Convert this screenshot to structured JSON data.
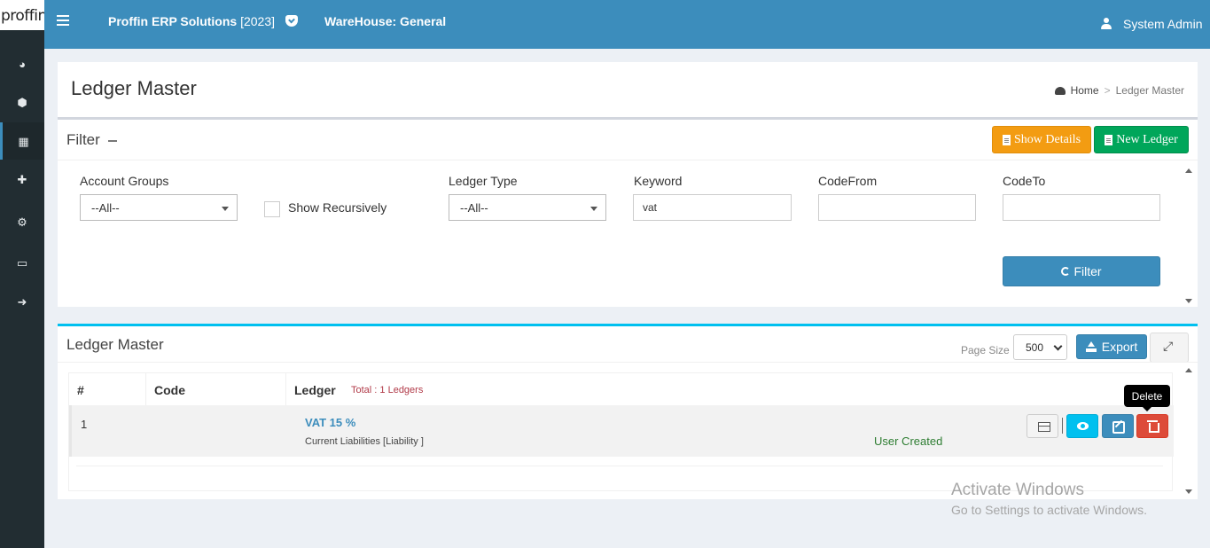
{
  "logo": {
    "text": "proffin"
  },
  "header": {
    "app_title": "Proffin ERP Solutions",
    "app_year": "[2023]",
    "warehouse": "WareHouse: General",
    "user_name": "System Admin"
  },
  "sidebar": {
    "items": [
      {
        "icon": "dashboard-icon"
      },
      {
        "icon": "cubes-icon"
      },
      {
        "icon": "calculator-icon",
        "active": true
      },
      {
        "icon": "puzzle-icon"
      },
      {
        "icon": "cogs-icon"
      },
      {
        "icon": "laptop-icon"
      },
      {
        "icon": "sign-out-icon"
      }
    ]
  },
  "page": {
    "title": "Ledger Master",
    "breadcrumb": {
      "home": "Home",
      "sep": ">",
      "current": "Ledger Master"
    }
  },
  "filter": {
    "title": "Filter",
    "show_details": "Show Details",
    "new_ledger": "New Ledger",
    "account_groups_label": "Account Groups",
    "account_groups_value": "--All--",
    "show_recursively": "Show Recursively",
    "ledger_type_label": "Ledger Type",
    "ledger_type_value": "--All--",
    "keyword_label": "Keyword",
    "keyword_value": "vat",
    "code_from_label": "CodeFrom",
    "code_from_value": "",
    "code_to_label": "CodeTo",
    "code_to_value": "",
    "filter_button": "Filter"
  },
  "ledger": {
    "title": "Ledger Master",
    "page_size_label": "Page Size",
    "page_size_value": "500",
    "export_button": "Export",
    "columns": {
      "num": "#",
      "code": "Code",
      "ledger": "Ledger"
    },
    "total_text": "Total : 1 Ledgers",
    "rows": [
      {
        "num": "1",
        "code": "",
        "name": "VAT 15 %",
        "group": "Current Liabilities [Liability ]",
        "status": "User Created"
      }
    ],
    "tooltip": "Delete"
  },
  "watermark": {
    "line1": "Activate Windows",
    "line2": "Go to Settings to activate Windows."
  },
  "colors": {
    "topbar": "#3c8dbc",
    "sidebar": "#222d32",
    "warning": "#f39c12",
    "success": "#00a65a",
    "info": "#00c0ef",
    "danger": "#dd4b39"
  }
}
